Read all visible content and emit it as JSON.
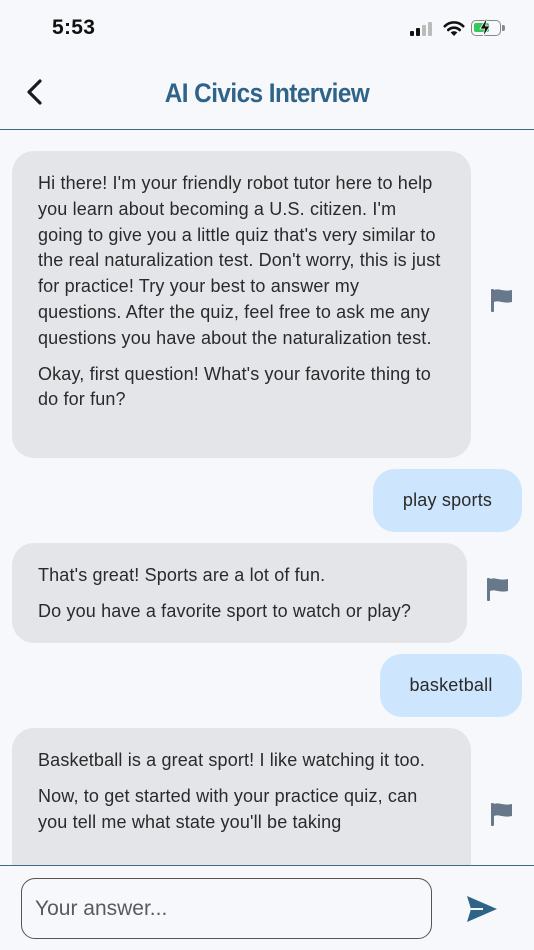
{
  "status_bar": {
    "time": "5:53"
  },
  "header": {
    "title": "AI Civics Interview",
    "back_icon": "chevron-left-icon",
    "accent_color": "#2f6488"
  },
  "messages": [
    {
      "role": "bot",
      "paragraphs": [
        "Hi there! I'm your friendly robot tutor here to help you learn about becoming a U.S. citizen. I'm going to give you a little quiz that's very similar to the real naturalization test.  Don't worry, this is just for practice!  Try your best to answer my questions.  After the quiz, feel free to ask me any questions you have about the naturalization test.",
        "Okay, first question! What's your favorite thing to do for fun?"
      ]
    },
    {
      "role": "user",
      "text": "play sports"
    },
    {
      "role": "bot",
      "paragraphs": [
        "That's great!  Sports are a lot of fun.",
        "Do you have a favorite sport to watch or play?"
      ]
    },
    {
      "role": "user",
      "text": "basketball"
    },
    {
      "role": "bot",
      "paragraphs": [
        "Basketball is a great sport!  I like watching it too.",
        "Now, to get started with your practice quiz, can you tell me what state you'll be taking"
      ]
    }
  ],
  "input": {
    "placeholder": "Your answer...",
    "value": ""
  },
  "icons": {
    "flag": "flag-icon",
    "send": "send-icon"
  },
  "colors": {
    "bot_bubble": "#e3e5e9",
    "user_bubble": "#cde6fd",
    "divider": "#3e6a86",
    "flag": "#66788a",
    "send": "#2f6488"
  }
}
